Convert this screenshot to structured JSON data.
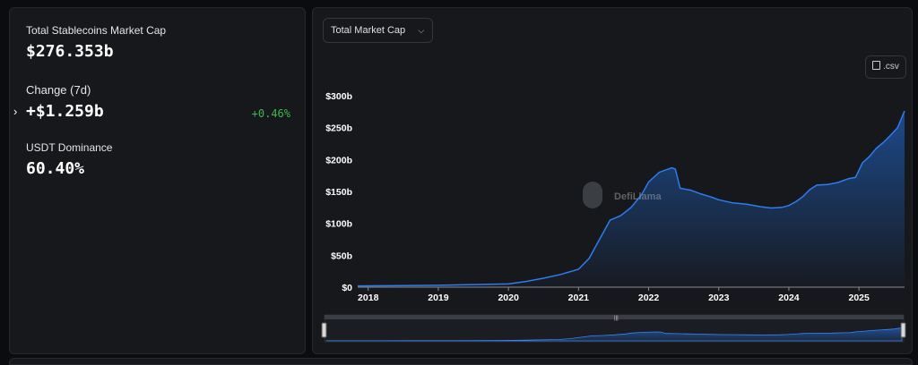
{
  "stats": {
    "market_cap_label": "Total Stablecoins Market Cap",
    "market_cap_value": "$276.353b",
    "change_label": "Change (7d)",
    "change_value": "+$1.259b",
    "change_pct": "+0.46%",
    "dominance_label": "USDT Dominance",
    "dominance_value": "60.40%"
  },
  "chart_header": {
    "dropdown_label": "Total Market Cap",
    "csv_label": ".csv"
  },
  "watermark": "DefiLlama",
  "colors": {
    "accent": "#2172e5",
    "positive": "#3fb950",
    "panel": "#17181c",
    "background": "#0b0c0f"
  },
  "chart_data": {
    "type": "area",
    "y_tick_labels": [
      "$0",
      "$50b",
      "$100b",
      "$150b",
      "$200b",
      "$250b",
      "$300b"
    ],
    "y_tick_values": [
      0,
      50,
      100,
      150,
      200,
      250,
      300
    ],
    "x_tick_labels": [
      "2018",
      "2019",
      "2020",
      "2021",
      "2022",
      "2023",
      "2024",
      "2025"
    ],
    "x_tick_values": [
      2018,
      2019,
      2020,
      2021,
      2022,
      2023,
      2024,
      2025
    ],
    "xlim": [
      2017.85,
      2025.65
    ],
    "ylim": [
      0,
      300
    ],
    "unit": "$b",
    "grid": false,
    "x": [
      2017.85,
      2018.5,
      2019.0,
      2019.5,
      2020.0,
      2020.25,
      2020.5,
      2020.75,
      2021.0,
      2021.15,
      2021.3,
      2021.45,
      2021.6,
      2021.75,
      2021.9,
      2022.0,
      2022.15,
      2022.33,
      2022.38,
      2022.45,
      2022.6,
      2022.75,
      2022.9,
      2023.0,
      2023.2,
      2023.4,
      2023.6,
      2023.75,
      2023.9,
      2024.0,
      2024.1,
      2024.2,
      2024.3,
      2024.4,
      2024.55,
      2024.7,
      2024.85,
      2024.95,
      2025.05,
      2025.15,
      2025.25,
      2025.35,
      2025.45,
      2025.55,
      2025.65
    ],
    "y": [
      2,
      2.5,
      3,
      4,
      5,
      9,
      14,
      20,
      28,
      45,
      75,
      105,
      112,
      125,
      145,
      165,
      180,
      187,
      185,
      155,
      152,
      146,
      141,
      137,
      132,
      130,
      126,
      124,
      125,
      128,
      134,
      142,
      153,
      160,
      161,
      164,
      170,
      172,
      195,
      205,
      218,
      227,
      238,
      250,
      276
    ]
  }
}
